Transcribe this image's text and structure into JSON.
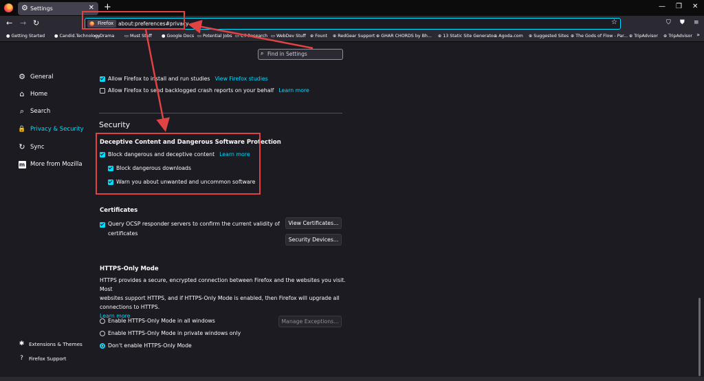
{
  "tab": {
    "title": "Settings",
    "close": "✕"
  },
  "newtab": "+",
  "window": {
    "minimize": "—",
    "maximize": "❐",
    "close": "✕"
  },
  "nav": {
    "back": "←",
    "forward": "→",
    "reload": "↻"
  },
  "urlbar": {
    "identity": "Firefox",
    "url": "about:preferences#privacy",
    "star": "☆"
  },
  "bookmarks": [
    {
      "icon": "●",
      "label": "Getting Started"
    },
    {
      "icon": "●",
      "label": "Candid.Technology"
    },
    {
      "icon": "▭",
      "label": "Drama"
    },
    {
      "icon": "▭",
      "label": "Must Stuff"
    },
    {
      "icon": "●",
      "label": "Google Docs"
    },
    {
      "icon": "▭",
      "label": "Potential Jobs"
    },
    {
      "icon": "▭",
      "label": "CT Research"
    },
    {
      "icon": "▭",
      "label": "WebDev Stuff"
    },
    {
      "icon": "⊕",
      "label": "Fount"
    },
    {
      "icon": "⊕",
      "label": "RedGear Support"
    },
    {
      "icon": "⊕",
      "label": "GHAR CHORDS by Bh..."
    },
    {
      "icon": "⊕",
      "label": "13 Static Site Generato..."
    },
    {
      "icon": "⊕",
      "label": "Agoda.com"
    },
    {
      "icon": "⊕",
      "label": "Suggested Sites"
    },
    {
      "icon": "⊕",
      "label": "The Gods of Flow - Par..."
    },
    {
      "icon": "⊕",
      "label": "TripAdvisor"
    },
    {
      "icon": "⊕",
      "label": "TripAdvisor"
    }
  ],
  "bookmarks_more": "»",
  "search": {
    "placeholder": "Find in Settings"
  },
  "sidebar": {
    "items": [
      {
        "icon": "⚙",
        "label": "General"
      },
      {
        "icon": "⌂",
        "label": "Home"
      },
      {
        "icon": "⌕",
        "label": "Search"
      },
      {
        "icon": "🔒",
        "label": "Privacy & Security"
      },
      {
        "icon": "↻",
        "label": "Sync"
      },
      {
        "icon": "m",
        "label": "More from Mozilla"
      }
    ],
    "bottom": [
      {
        "icon": "✱",
        "label": "Extensions & Themes"
      },
      {
        "icon": "?",
        "label": "Firefox Support"
      }
    ]
  },
  "studies": {
    "allow_studies": "Allow Firefox to install and run studies",
    "view_studies": "View Firefox studies",
    "allow_crash": "Allow Firefox to send backlogged crash reports on your behalf",
    "learn_more": "Learn more"
  },
  "security": {
    "heading": "Security",
    "deceptive_title": "Deceptive Content and Dangerous Software Protection",
    "block_deceptive": "Block dangerous and deceptive content",
    "learn_more": "Learn more",
    "block_downloads": "Block dangerous downloads",
    "warn_unwanted": "Warn you about unwanted and uncommon software"
  },
  "certificates": {
    "title": "Certificates",
    "ocsp_line1": "Query OCSP responder servers to confirm the current validity of",
    "ocsp_line2": "certificates",
    "view_button": "View Certificates...",
    "devices_button": "Security Devices..."
  },
  "https": {
    "title": "HTTPS-Only Mode",
    "desc_line1": "HTTPS provides a secure, encrypted connection between Firefox and the websites you visit. Most",
    "desc_line2": "websites support HTTPS, and if HTTPS-Only Mode is enabled, then Firefox will upgrade all",
    "desc_line3": "connections to HTTPS.",
    "learn_more": "Learn more",
    "opt_all": "Enable HTTPS-Only Mode in all windows",
    "opt_private": "Enable HTTPS-Only Mode in private windows only",
    "opt_none": "Don't enable HTTPS-Only Mode",
    "manage_button": "Manage Exceptions..."
  },
  "colors": {
    "accent": "#00ddff",
    "annotation": "#e04343",
    "background": "#1c1b22"
  }
}
